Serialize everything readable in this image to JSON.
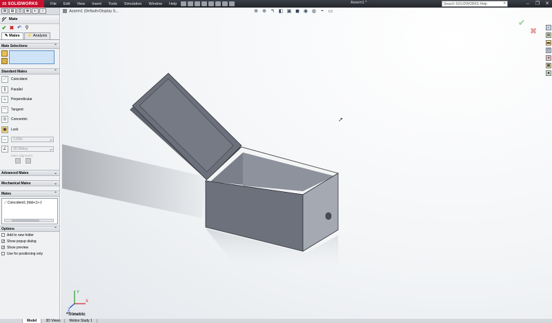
{
  "app": {
    "brand": "SOLIDWORKS",
    "brand_prefix": "3S",
    "document_title": "Assem1 *",
    "search_placeholder": "Search SOLIDWORKS Help"
  },
  "menu": [
    "File",
    "Edit",
    "View",
    "Insert",
    "Tools",
    "Simulation",
    "Window",
    "Help"
  ],
  "window_controls": [
    "minimize",
    "restore",
    "close"
  ],
  "panel": {
    "title": "Mate",
    "tabs": [
      "Mates",
      "Analysis"
    ],
    "mate_selections": {
      "header": "Mate Selections"
    },
    "standard_mates": {
      "header": "Standard Mates",
      "items": [
        "Coincident",
        "Parallel",
        "Perpendicular",
        "Tangent",
        "Concentric",
        "Lock"
      ],
      "distance_value": "1.00in",
      "angle_value": "30.00deg",
      "alignment_label": "Mate alignment:"
    },
    "advanced_mates": {
      "header": "Advanced Mates"
    },
    "mechanical_mates": {
      "header": "Mechanical Mates"
    },
    "mates": {
      "header": "Mates",
      "item": "Coincident1 (hbb<1>,f"
    },
    "options": {
      "header": "Options",
      "items": [
        {
          "label": "Add to new folder",
          "checked": false
        },
        {
          "label": "Show popup dialog",
          "checked": true
        },
        {
          "label": "Show preview",
          "checked": true
        },
        {
          "label": "Use for positioning only",
          "checked": false
        }
      ]
    }
  },
  "viewport": {
    "tree_flyout": "Assem1  (Default<Display S...",
    "view_orientation": "*Trimetric",
    "triad": {
      "x": "X",
      "y": "Y",
      "z": "Z"
    }
  },
  "bottom_tabs": [
    "Model",
    "3D Views",
    "Motion Study 1"
  ],
  "colors": {
    "brand_red": "#c8102e",
    "model_gray": "#6d717c",
    "model_lid_top": "#7a7e89",
    "ok_green": "#2a9a2a",
    "cancel_red": "#d02020"
  }
}
